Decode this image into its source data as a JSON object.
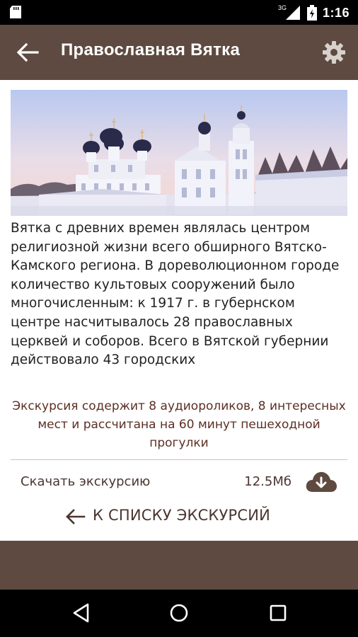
{
  "status_bar": {
    "network": "3G",
    "time": "1:16",
    "icons": [
      "sd-card-icon",
      "signal-icon",
      "battery-icon"
    ]
  },
  "app_bar": {
    "title": "Православная Вятка",
    "back_icon": "arrow-back-icon",
    "settings_icon": "gear-icon"
  },
  "content": {
    "image_icon": "church-photo",
    "description": "Вятка с древних времен являлась центром религиозной жизни всего обширного Вятско-Камского региона. В дореволюционном городе количество культовых сооружений было многочисленным: к 1917 г. в губернском центре насчитывалось 28 православных церквей и соборов. Всего в Вятской губернии действовало 43 городских",
    "summary": "Экскурсия содержит 8 аудиороликов, 8 интересных мест и рассчитана на 60 минут пешеходной прогулки",
    "download": {
      "label": "Скачать экскурсию",
      "size": "12.5Мб",
      "icon": "cloud-download-icon"
    },
    "back_to_list": {
      "label": "К СПИСКУ ЭКСКУРСИЙ",
      "icon": "arrow-left-icon"
    }
  },
  "colors": {
    "app_bar": "#5e4a40",
    "summary_text": "#5b2f23",
    "button_text": "#4a3530"
  },
  "nav_bar": {
    "icons": [
      "nav-back-icon",
      "nav-home-icon",
      "nav-recent-icon"
    ]
  }
}
